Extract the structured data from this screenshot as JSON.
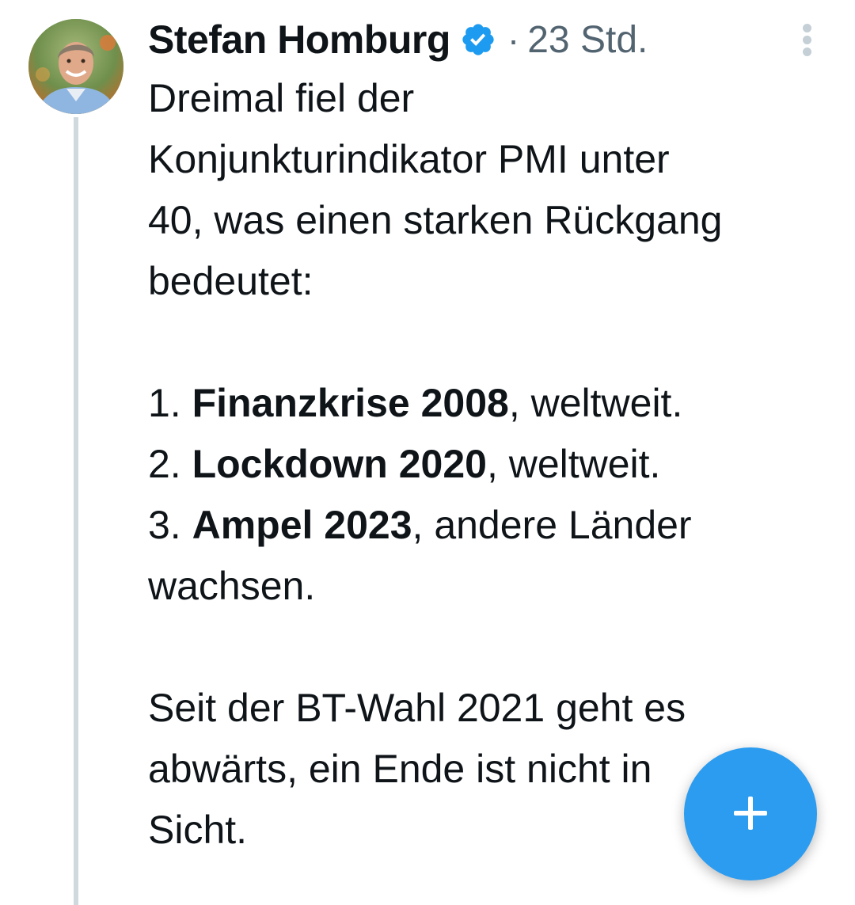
{
  "tweet": {
    "author": {
      "name": "Stefan Homburg",
      "verified": true,
      "avatar_icon": "profile-photo"
    },
    "separator": "·",
    "timestamp": "23 Std.",
    "more_icon": "vertical-ellipsis-icon",
    "text": {
      "intro_lines": [
        "Dreimal fiel der",
        "Konjunkturindikator PMI unter",
        "40, was einen starken Rückgang",
        "bedeutet:"
      ],
      "items": [
        {
          "number": "1. ",
          "bold": "Finanzkrise 2008",
          "rest": ", weltweit."
        },
        {
          "number": "2. ",
          "bold": "Lockdown 2020",
          "rest": ", weltweit."
        },
        {
          "number": "3. ",
          "bold": "Ampel 2023",
          "rest": ", andere Länder"
        }
      ],
      "item3_continuation": "wachsen.",
      "outro_lines": [
        "Seit der BT-Wahl 2021 geht es",
        "abwärts, ein Ende ist nicht in",
        "Sicht."
      ]
    }
  },
  "fab": {
    "icon": "plus-icon",
    "label": "+"
  },
  "colors": {
    "verified_badge": "#1d9bf0",
    "fab_background": "#2b9cf0",
    "text_primary": "#0f1419",
    "text_secondary": "#536471",
    "thread_line": "#cfd9de"
  }
}
